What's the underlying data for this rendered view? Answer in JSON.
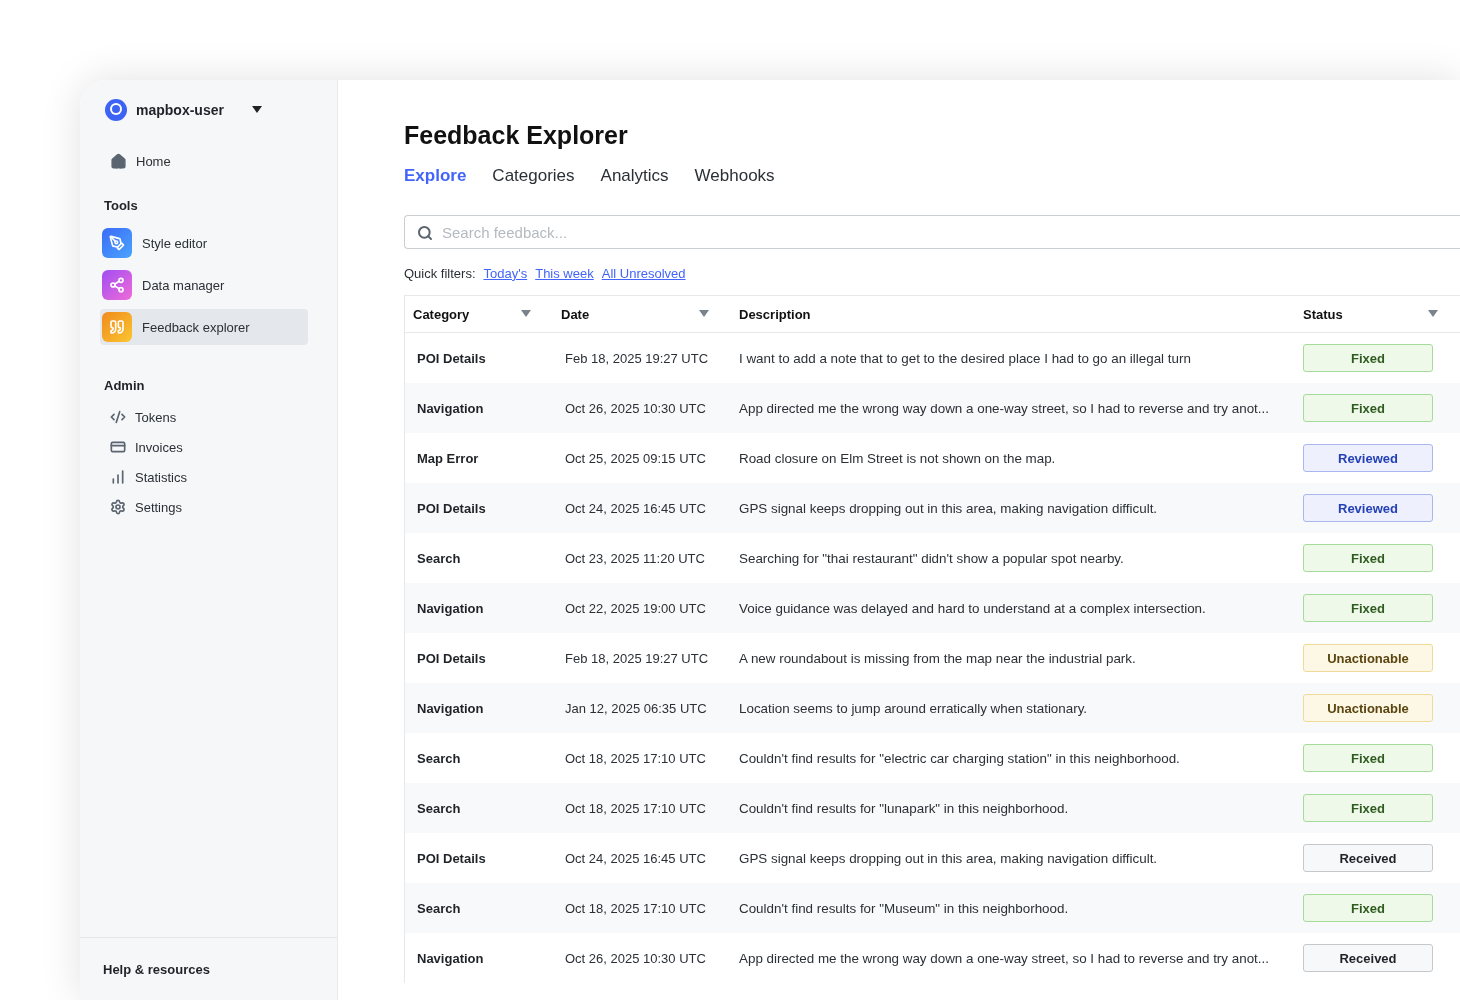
{
  "sidebar": {
    "account": {
      "name": "mapbox-user"
    },
    "home": {
      "label": "Home"
    },
    "sections": [
      {
        "title": "Tools",
        "kind": "tools",
        "items": [
          {
            "label": "Style editor",
            "selected": false
          },
          {
            "label": "Data manager",
            "selected": false
          },
          {
            "label": "Feedback explorer",
            "selected": true
          }
        ]
      },
      {
        "title": "Admin",
        "kind": "admin",
        "items": [
          {
            "label": "Tokens",
            "selected": false
          },
          {
            "label": "Invoices",
            "selected": false
          },
          {
            "label": "Statistics",
            "selected": false
          },
          {
            "label": "Settings",
            "selected": false
          }
        ]
      }
    ],
    "footer": {
      "label": "Help & resources"
    }
  },
  "page": {
    "title": "Feedback Explorer",
    "tabs": [
      {
        "label": "Explore",
        "selected": true
      },
      {
        "label": "Categories",
        "selected": false
      },
      {
        "label": "Analytics",
        "selected": false
      },
      {
        "label": "Webhooks",
        "selected": false
      }
    ],
    "search": {
      "placeholder": "Search feedback..."
    },
    "quick_filters": {
      "label": "Quick filters:",
      "links": [
        "Today's",
        "This week",
        "All Unresolved"
      ]
    }
  },
  "table": {
    "columns": [
      {
        "label": "Category",
        "sortable": true
      },
      {
        "label": "Date",
        "sortable": true
      },
      {
        "label": "Description",
        "sortable": false
      },
      {
        "label": "Status",
        "sortable": true
      }
    ],
    "rows": [
      {
        "category": "POI Details",
        "date": "Feb 18, 2025 19:27 UTC",
        "description": "I want to add a note that to get to the desired place I had to go an illegal turn",
        "status": {
          "label": "Fixed",
          "kind": "fixed"
        }
      },
      {
        "category": "Navigation",
        "date": "Oct 26, 2025 10:30 UTC",
        "description": "App directed me the wrong way down a one-way street, so I had to reverse and try anot...",
        "status": {
          "label": "Fixed",
          "kind": "fixed"
        }
      },
      {
        "category": "Map Error",
        "date": "Oct 25, 2025 09:15 UTC",
        "description": "Road closure on Elm Street is not shown on the map.",
        "status": {
          "label": "Reviewed",
          "kind": "reviewed"
        }
      },
      {
        "category": "POI Details",
        "date": "Oct 24, 2025 16:45 UTC",
        "description": "GPS signal keeps dropping out in this area, making navigation difficult.",
        "status": {
          "label": "Reviewed",
          "kind": "reviewed"
        }
      },
      {
        "category": "Search",
        "date": "Oct 23, 2025 11:20 UTC",
        "description": "Searching for \"thai restaurant\" didn't show a popular spot nearby.",
        "status": {
          "label": "Fixed",
          "kind": "fixed"
        }
      },
      {
        "category": "Navigation",
        "date": "Oct 22, 2025 19:00 UTC",
        "description": "Voice guidance was delayed and hard to understand at a complex intersection.",
        "status": {
          "label": "Fixed",
          "kind": "fixed"
        }
      },
      {
        "category": "POI Details",
        "date": "Feb 18, 2025 19:27 UTC",
        "description": "A new roundabout is missing from the map near the industrial park.",
        "status": {
          "label": "Unactionable",
          "kind": "unactionable"
        }
      },
      {
        "category": "Navigation",
        "date": "Jan 12, 2025 06:35 UTC",
        "description": "Location seems to jump around erratically when stationary.",
        "status": {
          "label": "Unactionable",
          "kind": "unactionable"
        }
      },
      {
        "category": "Search",
        "date": "Oct 18, 2025 17:10 UTC",
        "description": "Couldn't find results for \"electric car charging station\" in this neighborhood.",
        "status": {
          "label": "Fixed",
          "kind": "fixed"
        }
      },
      {
        "category": "Search",
        "date": "Oct 18, 2025 17:10 UTC",
        "description": "Couldn't find results for \"lunapark\" in this neighborhood.",
        "status": {
          "label": "Fixed",
          "kind": "fixed"
        }
      },
      {
        "category": "POI Details",
        "date": "Oct 24, 2025 16:45 UTC",
        "description": "GPS signal keeps dropping out in this area, making navigation difficult.",
        "status": {
          "label": "Received",
          "kind": "received"
        }
      },
      {
        "category": "Search",
        "date": "Oct 18, 2025 17:10 UTC",
        "description": "Couldn't find results for \"Museum\" in this neighborhood.",
        "status": {
          "label": "Fixed",
          "kind": "fixed"
        }
      },
      {
        "category": "Navigation",
        "date": "Oct 26, 2025 10:30 UTC",
        "description": "App directed me the wrong way down a one-way street, so I had to reverse and try anot...",
        "status": {
          "label": "Received",
          "kind": "received"
        }
      }
    ]
  }
}
